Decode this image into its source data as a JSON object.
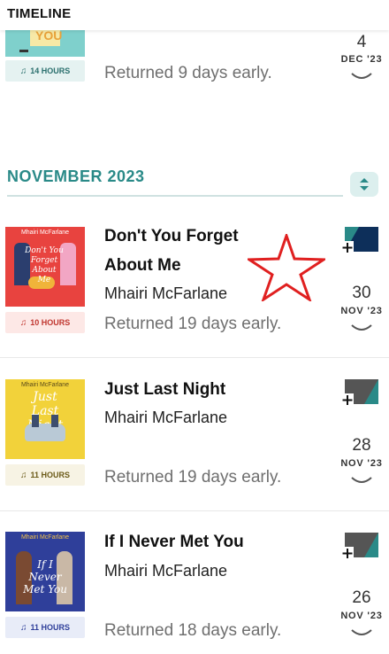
{
  "header": {
    "title": "TIMELINE"
  },
  "top_entry": {
    "duration": "14 HOURS",
    "returned": "Returned 9 days early.",
    "day": "4",
    "month": "DEC '23",
    "cover_text": "YOU"
  },
  "section": {
    "title": "NOVEMBER 2023"
  },
  "entries": [
    {
      "title_line1": "Don't You Forget",
      "title_line2": "About Me",
      "author": "Mhairi McFarlane",
      "returned": "Returned 19 days early.",
      "duration": "10 HOURS",
      "day": "30",
      "month": "NOV '23",
      "cover_author": "Mhairi McFarlane",
      "cover_title": "Don't You Forget About Me",
      "accent": "#e8433f"
    },
    {
      "title_line1": "Just Last Night",
      "author": "Mhairi McFarlane",
      "returned": "Returned 19 days early.",
      "duration": "11 HOURS",
      "day": "28",
      "month": "NOV '23",
      "cover_author": "Mhairi McFarlane",
      "cover_title": "Just Last Night",
      "accent": "#f2d23a"
    },
    {
      "title_line1": "If I Never Met You",
      "author": "Mhairi McFarlane",
      "returned": "Returned 18 days early.",
      "duration": "11 HOURS",
      "day": "26",
      "month": "NOV '23",
      "cover_author": "Mhairi McFarlane",
      "cover_title": "If I Never Met You",
      "accent": "#2f3f9a"
    }
  ],
  "colors": {
    "section_teal": "#2a8a88",
    "annotation_red": "#e02020"
  },
  "icons": [
    "chevron-down-icon",
    "headphones-icon",
    "add-to-shelf-icon",
    "collapse-toggle-icon",
    "star-annotation-icon"
  ]
}
